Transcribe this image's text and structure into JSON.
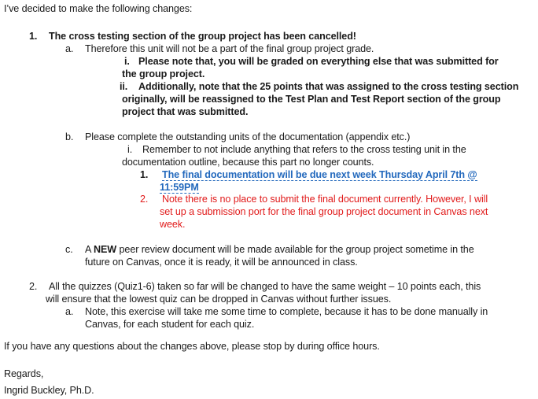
{
  "intro": "I’ve decided to make the following changes:",
  "item1": {
    "num": "1.",
    "title": "The cross testing section of the group project has been cancelled!",
    "a": {
      "marker": "a.",
      "text": "Therefore this unit will not be a part of the final group project grade.",
      "i": {
        "marker": "i.",
        "line1": "Please note that, you will be graded on everything else that was submitted for",
        "line2": "the group project."
      },
      "ii": {
        "marker": "ii.",
        "line1": "Additionally, note that the 25 points that was assigned to the cross testing section",
        "line2": "originally, will be reassigned to the Test Plan and Test Report section of the group",
        "line3": "project that was submitted."
      }
    },
    "b": {
      "marker": "b.",
      "text": "Please complete the outstanding units of the documentation (appendix etc.)",
      "i": {
        "marker": "i.",
        "line1": "Remember to not include anything that refers to the cross testing unit in the",
        "line2": "documentation outline, because this part no longer counts."
      },
      "n1": {
        "marker": "1.",
        "line1": "The final documentation will be due next week Thursday April 7th @",
        "line2": "11:59PM"
      },
      "n2": {
        "marker": "2.",
        "line1": "Note there is no place to submit the final document currently. However, I will",
        "line2": "set up a submission port for the final group project document in Canvas next",
        "line3": "week."
      }
    },
    "c": {
      "marker": "c.",
      "pre": "A ",
      "bold": "NEW",
      "line1_rest": " peer review document will be made available for the group project sometime in the",
      "line2": "future on Canvas, once it is ready,  it will be announced in class."
    }
  },
  "item2": {
    "num": "2.",
    "line1": "All the quizzes (Quiz1-6)  taken so far will be changed to have the same weight – 10 points each, this",
    "line2": "will ensure that the lowest quiz can be dropped in Canvas without further issues.",
    "a": {
      "marker": "a.",
      "line1": "Note, this exercise will take me some time to complete, because it has to be done manually in",
      "line2": "Canvas, for each student for each quiz."
    }
  },
  "closing": "If you have any questions about the changes above, please stop by during office hours.",
  "regards": "Regards,",
  "signature": "Ingrid Buckley, Ph.D.",
  "colors": {
    "blue": "#2369bd",
    "red": "#e11b1b"
  }
}
